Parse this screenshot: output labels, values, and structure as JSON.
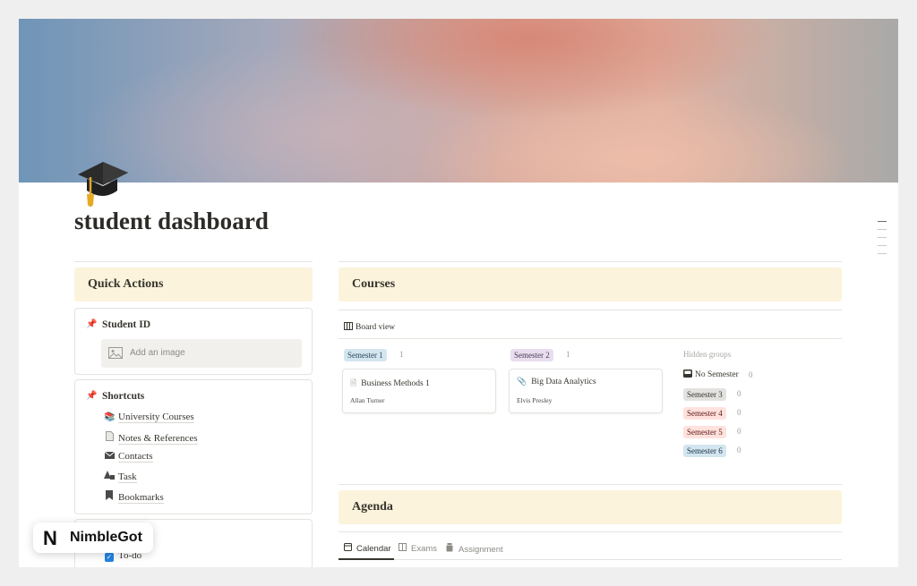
{
  "page": {
    "title": "student dashboard"
  },
  "quick_actions": {
    "heading": "Quick Actions",
    "student_id": {
      "title": "Student ID",
      "image_placeholder": "Add an image"
    },
    "shortcuts": {
      "title": "Shortcuts",
      "items": [
        {
          "label": "University Courses",
          "icon": "books-icon"
        },
        {
          "label": "Notes & References",
          "icon": "page-icon"
        },
        {
          "label": "Contacts",
          "icon": "envelope-icon"
        },
        {
          "label": "Task",
          "icon": "shapes-icon"
        },
        {
          "label": "Bookmarks",
          "icon": "bookmark-icon"
        }
      ]
    },
    "todo": {
      "label": "To-do"
    }
  },
  "courses": {
    "heading": "Courses",
    "view_label": "Board view",
    "groups": [
      {
        "name": "Semester 1",
        "count": "1",
        "color": "#d3e5ef",
        "cards": [
          {
            "title": "Business Methods 1",
            "person": "Allan Turner",
            "icon": "page-icon"
          }
        ]
      },
      {
        "name": "Semester 2",
        "count": "1",
        "color": "#e8deee",
        "cards": [
          {
            "title": "Big Data Analytics",
            "person": "Elvis Presley",
            "icon": "paperclip-icon"
          }
        ]
      }
    ],
    "hidden_groups": {
      "label": "Hidden groups",
      "no_semester": {
        "label": "No Semester",
        "count": "0"
      },
      "items": [
        {
          "name": "Semester 3",
          "count": "0",
          "color": "#e3e2e0"
        },
        {
          "name": "Semester 4",
          "count": "0",
          "color": "#ffe2dd"
        },
        {
          "name": "Semester 5",
          "count": "0",
          "color": "#ffe2dd"
        },
        {
          "name": "Semester 6",
          "count": "0",
          "color": "#d3e5ef"
        }
      ]
    }
  },
  "agenda": {
    "heading": "Agenda",
    "tabs": [
      {
        "label": "Calendar",
        "icon": "calendar-icon",
        "active": true
      },
      {
        "label": "Exams",
        "icon": "book-icon",
        "active": false
      },
      {
        "label": "Assignment",
        "icon": "jar-icon",
        "active": false
      }
    ]
  },
  "watermark": {
    "brand": "NimbleGot",
    "mark": "N"
  }
}
